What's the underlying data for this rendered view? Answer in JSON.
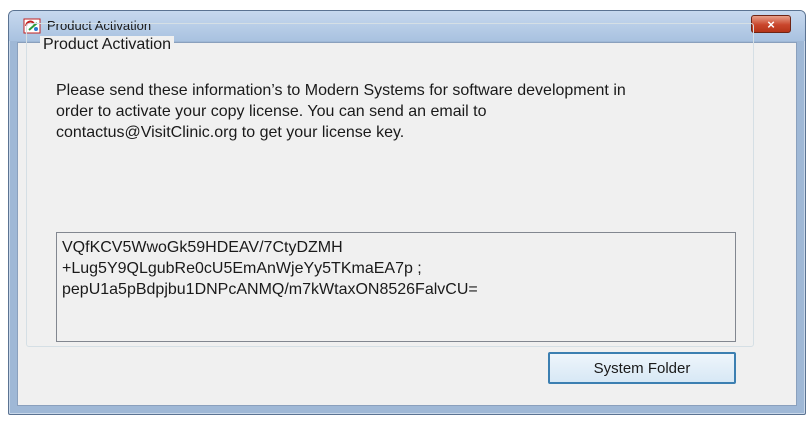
{
  "window": {
    "title": "Product Activation",
    "close_label": "×"
  },
  "groupbox": {
    "legend": "Product Activation"
  },
  "message": {
    "lines": [
      "Please send these information’s to Modern Systems for software development in",
      "order to activate your copy license. You can send an email to",
      "contactus@VisitClinic.org to get your license key."
    ]
  },
  "activation_code": {
    "lines": [
      "VQfKCV5WwoGk59HDEAV/7CtyDZMH",
      "+Lug5Y9QLgubRe0cU5EmAnWjeYy5TKmaEA7p   ;",
      "pepU1a5pBdpjbu1DNPcANMQ/m7kWtaxON8526FalvCU="
    ]
  },
  "buttons": {
    "system_folder": "System Folder"
  },
  "icons": {
    "app": "app-logo-icon",
    "close": "close-icon"
  },
  "colors": {
    "frame": "#9fb8d6",
    "close_button": "#c9462c",
    "button_border": "#3c7fb1"
  }
}
